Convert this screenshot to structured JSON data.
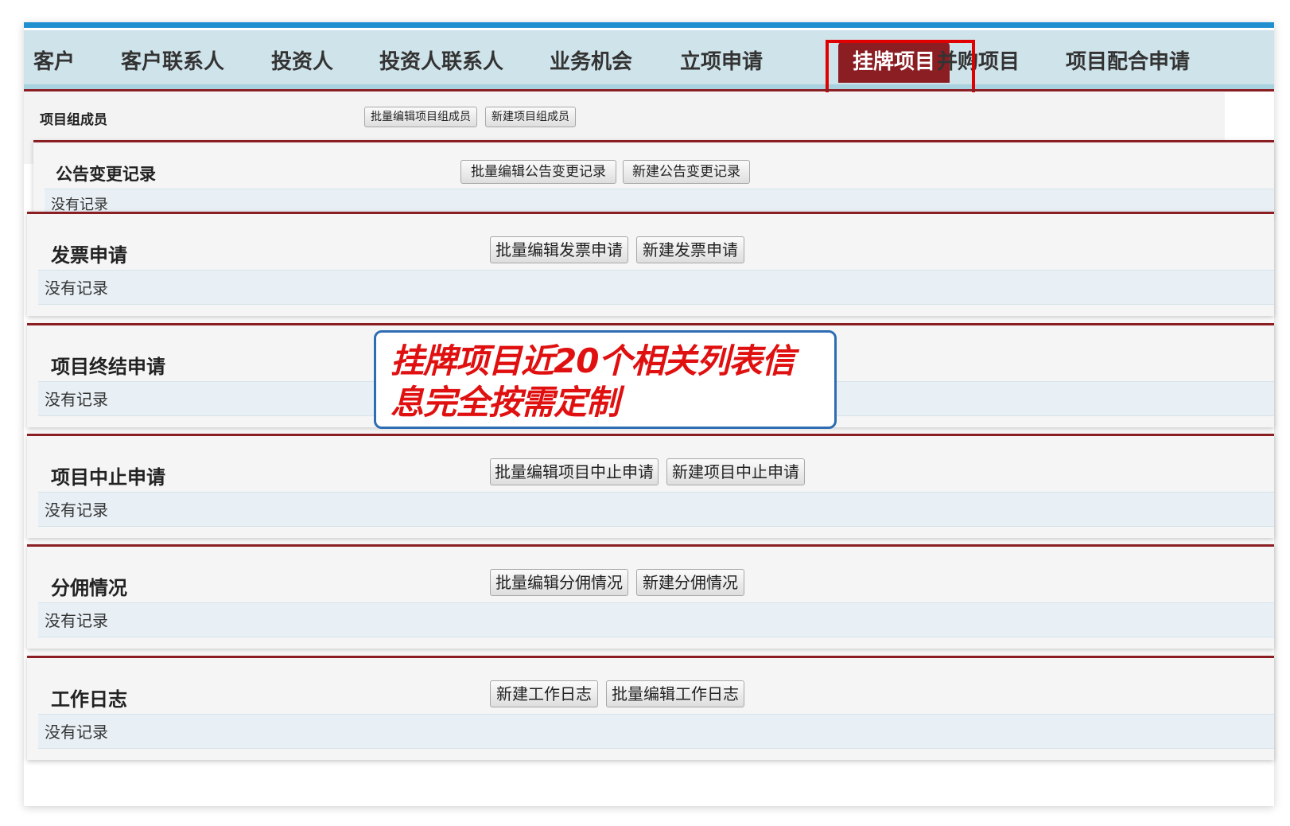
{
  "tabs": [
    {
      "label": "客户"
    },
    {
      "label": "客户联系人"
    },
    {
      "label": "投资人"
    },
    {
      "label": "投资人联系人"
    },
    {
      "label": "业务机会"
    },
    {
      "label": "立项申请"
    },
    {
      "label": "挂牌项目",
      "active": true
    },
    {
      "label": "并购项目"
    },
    {
      "label": "项目配合申请"
    }
  ],
  "sections": {
    "team": {
      "title": "项目组成员",
      "buttons": [
        "批量编辑项目组成员",
        "新建项目组成员"
      ]
    },
    "announce": {
      "title": "公告变更记录",
      "buttons": [
        "批量编辑公告变更记录",
        "新建公告变更记录"
      ],
      "empty": "没有记录"
    },
    "invoice": {
      "title": "发票申请",
      "buttons": [
        "批量编辑发票申请",
        "新建发票申请"
      ],
      "empty": "没有记录"
    },
    "terminate": {
      "title": "项目终结申请",
      "empty": "没有记录"
    },
    "suspend": {
      "title": "项目中止申请",
      "buttons": [
        "批量编辑项目中止申请",
        "新建项目中止申请"
      ],
      "empty": "没有记录"
    },
    "commission": {
      "title": "分佣情况",
      "buttons": [
        "批量编辑分佣情况",
        "新建分佣情况"
      ],
      "empty": "没有记录"
    },
    "worklog": {
      "title": "工作日志",
      "buttons": [
        "新建工作日志",
        "批量编辑工作日志"
      ],
      "empty": "没有记录"
    }
  },
  "callout": {
    "line1": "挂牌项目近20个相关列表信",
    "line2": "息完全按需定制"
  },
  "colors": {
    "accent_red": "#8b1e23",
    "highlight_red": "#e00000",
    "callout_border": "#2e6db3",
    "callout_text": "#e01010"
  }
}
